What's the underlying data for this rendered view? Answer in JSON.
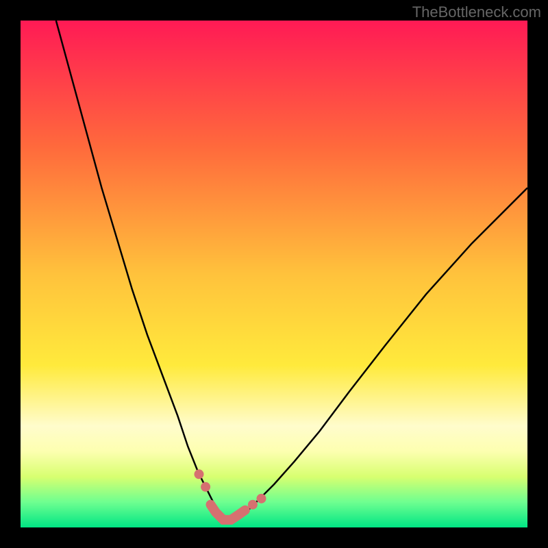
{
  "watermark": "TheBottleneck.com",
  "chart_data": {
    "type": "line",
    "title": "",
    "xlabel": "",
    "ylabel": "",
    "xlim": [
      0,
      100
    ],
    "ylim": [
      0,
      100
    ],
    "background_gradient": {
      "stops": [
        {
          "offset": 0,
          "color": "#ff1a55"
        },
        {
          "offset": 25,
          "color": "#ff6a3c"
        },
        {
          "offset": 50,
          "color": "#ffc23c"
        },
        {
          "offset": 68,
          "color": "#ffea3c"
        },
        {
          "offset": 80,
          "color": "#fffccc"
        },
        {
          "offset": 85,
          "color": "#fdffb0"
        },
        {
          "offset": 90,
          "color": "#d8ff70"
        },
        {
          "offset": 95,
          "color": "#6eff90"
        },
        {
          "offset": 100,
          "color": "#00e584"
        }
      ]
    },
    "left_curve": {
      "x": [
        7,
        10,
        13,
        16,
        19,
        22,
        25,
        28,
        31,
        33,
        35,
        37,
        38.5,
        39.5,
        40.2,
        41
      ],
      "y": [
        100,
        89,
        78,
        67,
        57,
        47,
        38,
        30,
        22,
        16,
        11,
        7,
        4,
        2.5,
        1.5,
        1
      ]
    },
    "right_curve": {
      "x": [
        41,
        42,
        43.5,
        45,
        47,
        50,
        54,
        59,
        65,
        72,
        80,
        89,
        100
      ],
      "y": [
        1,
        1.5,
        2.3,
        3.5,
        5.5,
        8.5,
        13,
        19,
        27,
        36,
        46,
        56,
        67
      ]
    },
    "dots": [
      {
        "x": 35.2,
        "y": 10.5,
        "r": 7
      },
      {
        "x": 36.5,
        "y": 8,
        "r": 7
      },
      {
        "x": 45.8,
        "y": 4.5,
        "r": 7
      },
      {
        "x": 47.5,
        "y": 5.7,
        "r": 7
      }
    ],
    "bottom_band": {
      "x": [
        37.5,
        38.5,
        40,
        41.5,
        43,
        44.3
      ],
      "y": [
        4.5,
        3,
        1.5,
        1.5,
        2.5,
        3.4
      ]
    }
  }
}
